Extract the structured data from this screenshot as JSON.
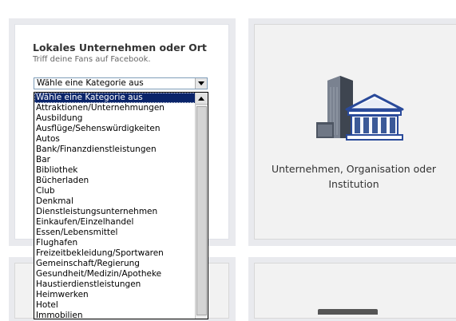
{
  "local_card": {
    "title": "Lokales Unternehmen oder Ort",
    "subtitle": "Triff deine Fans auf Facebook.",
    "select": {
      "selected_value": "Wähle eine Kategorie aus"
    },
    "options": [
      "Wähle eine Kategorie aus",
      "Attraktionen/Unternehmungen",
      "Ausbildung",
      "Ausflüge/Sehenswürdigkeiten",
      "Autos",
      "Bank/Finanzdienstleistungen",
      "Bar",
      "Bibliothek",
      "Bücherladen",
      "Club",
      "Denkmal",
      "Dienstleistungsunternehmen",
      "Einkaufen/Einzelhandel",
      "Essen/Lebensmittel",
      "Flughafen",
      "Freizeitbekleidung/Sportwaren",
      "Gemeinschaft/Regierung",
      "Gesundheit/Medizin/Apotheke",
      "Haustierdienstleistungen",
      "Heimwerken",
      "Hotel",
      "Immobilien"
    ]
  },
  "company_card": {
    "label": "Unternehmen, Organisation oder Institution",
    "icon": "company-building-icon"
  },
  "colors": {
    "tile_frame": "#e9eaee",
    "selection_bg": "#0a246a",
    "building_blue": "#3b5998"
  }
}
